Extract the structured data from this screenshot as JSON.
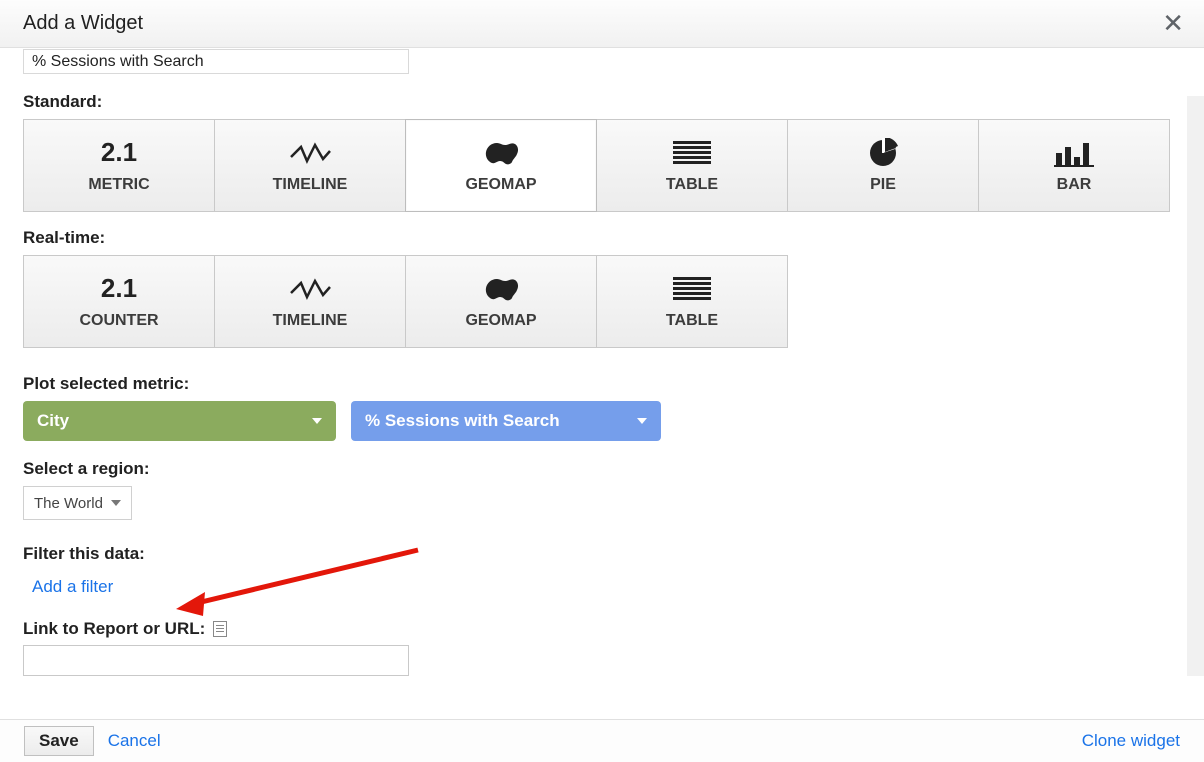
{
  "header": {
    "title": "Add a Widget"
  },
  "title_field": {
    "value": "% Sessions with Search"
  },
  "sections": {
    "standard_label": "Standard:",
    "realtime_label": "Real-time:",
    "plot_label": "Plot selected metric:",
    "region_label": "Select a region:",
    "filter_label": "Filter this data:",
    "link_label": "Link to Report or URL:"
  },
  "standard": [
    {
      "label": "METRIC",
      "icon": "metric"
    },
    {
      "label": "TIMELINE",
      "icon": "timeline"
    },
    {
      "label": "GEOMAP",
      "icon": "geomap",
      "selected": true
    },
    {
      "label": "TABLE",
      "icon": "table"
    },
    {
      "label": "PIE",
      "icon": "pie"
    },
    {
      "label": "BAR",
      "icon": "bar"
    }
  ],
  "realtime": [
    {
      "label": "COUNTER",
      "icon": "metric"
    },
    {
      "label": "TIMELINE",
      "icon": "timeline"
    },
    {
      "label": "GEOMAP",
      "icon": "geomap"
    },
    {
      "label": "TABLE",
      "icon": "table"
    }
  ],
  "plot": {
    "dimension": "City",
    "metric": "% Sessions with Search"
  },
  "region": {
    "selected": "The World"
  },
  "filter": {
    "add_label": "Add a filter"
  },
  "link_field": {
    "value": ""
  },
  "footer": {
    "save": "Save",
    "cancel": "Cancel",
    "clone": "Clone widget"
  }
}
